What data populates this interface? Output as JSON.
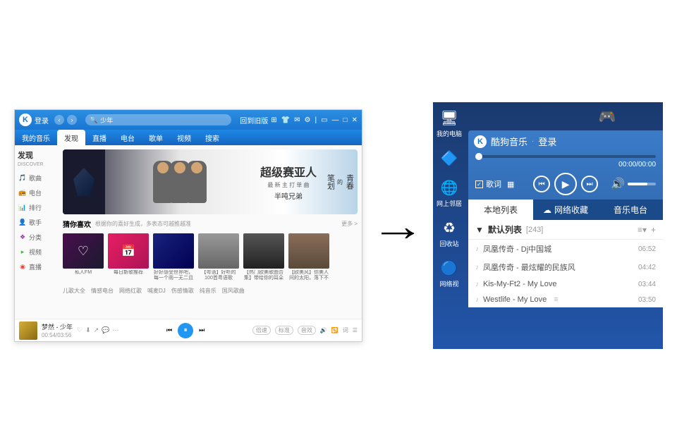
{
  "left": {
    "titlebar": {
      "login": "登录",
      "search_text": "少年",
      "return_btn": "回到旧版"
    },
    "tabs": [
      "我的音乐",
      "发现",
      "直播",
      "电台",
      "歌单",
      "视频",
      "搜索"
    ],
    "active_tab": 1,
    "sidebar": {
      "title": "发现",
      "subtitle": "DISCOVER",
      "items": [
        {
          "icon": "🎵",
          "label": "歌曲"
        },
        {
          "icon": "📻",
          "label": "电台"
        },
        {
          "icon": "📊",
          "label": "排行"
        },
        {
          "icon": "👤",
          "label": "歌手"
        },
        {
          "icon": "❖",
          "label": "分类"
        },
        {
          "icon": "▸",
          "label": "视频"
        },
        {
          "icon": "◉",
          "label": "直播"
        }
      ]
    },
    "banner": {
      "title": "超级赛亚人",
      "sub": "最 新 主 打 单 曲",
      "artist": "半吨兄弟",
      "right1": "青春",
      "right2": "笔划",
      "right_of": "的"
    },
    "rec": {
      "title": "猜你喜欢",
      "subtitle": "根据你的喜好生成，多表态可越推越准",
      "more": "更多 >",
      "thumbs": [
        {
          "label": "私人FM"
        },
        {
          "label": "每日新歌推荐",
          "badge": "15"
        },
        {
          "label": "好好感受世界吧，每一个雨一无二且闪…"
        },
        {
          "label": "【粤语】好听的100首粤语歌"
        },
        {
          "label": "【热门欧美歌曲合集】带给你的耳朵"
        },
        {
          "label": "【欧美风】你美人间的太阳，落下不可及"
        }
      ],
      "tags": [
        "儿歌大全",
        "情感电台",
        "网络红歌",
        "喊麦DJ",
        "伤感情歌",
        "纯音乐",
        "国风歌曲"
      ]
    },
    "player": {
      "track": "梦然 - 少年",
      "time": "00:54/03:56",
      "quality": "标准",
      "effect": "音效",
      "speed": "倍速"
    }
  },
  "right": {
    "desktop": [
      {
        "icon": "🖥",
        "label": "我的电脑"
      },
      {
        "icon": "🔷",
        "label": ""
      },
      {
        "icon": "🌐",
        "label": "网上邻居"
      },
      {
        "icon": "♻",
        "label": "回收站"
      },
      {
        "icon": "🔵",
        "label": "网络视"
      }
    ],
    "desktop_top": [
      {
        "icon": "🎮",
        "label": ""
      }
    ],
    "mini": {
      "app": "酷狗音乐",
      "login": "登录",
      "time": "00:00/00:00",
      "lyric": "歌词",
      "tabs": [
        {
          "label": "本地列表"
        },
        {
          "label": "网络收藏",
          "icon": "☁"
        },
        {
          "label": "音乐电台"
        }
      ],
      "active_tab": 0,
      "playlist_name": "默认列表",
      "playlist_count": "[243]",
      "items": [
        {
          "title": "凤凰传奇 - Dj中国城",
          "dur": "06:52"
        },
        {
          "title": "凤凰传奇 - 最炫耀的民族风",
          "dur": "04:42"
        },
        {
          "title": "Kis-My-Ft2 - My Love",
          "dur": "03:44"
        },
        {
          "title": "Westlife - My Love",
          "dur": "03:50"
        }
      ]
    }
  }
}
